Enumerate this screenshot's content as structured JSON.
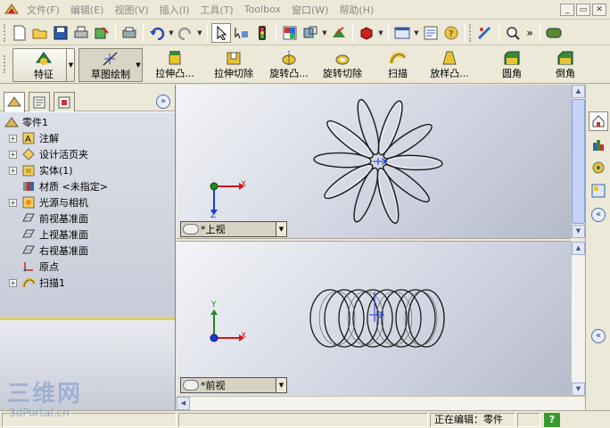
{
  "menu": {
    "items": [
      "文件(F)",
      "编辑(E)",
      "视图(V)",
      "插入(I)",
      "工具(T)",
      "Toolbox",
      "窗口(W)",
      "帮助(H)"
    ]
  },
  "command_manager": {
    "features_label": "特征",
    "sketch_label": "草图绘制",
    "commands": [
      "拉伸凸...",
      "拉伸切除",
      "旋转凸...",
      "旋转切除",
      "扫描",
      "放样凸...",
      "圆角",
      "倒角"
    ]
  },
  "feature_tree": {
    "root": "零件1",
    "items": [
      {
        "label": "注解",
        "icon": "annotation-icon",
        "expandable": true
      },
      {
        "label": "设计活页夹",
        "icon": "design-binder-icon",
        "expandable": true
      },
      {
        "label": "实体(1)",
        "icon": "solid-bodies-icon",
        "expandable": true
      },
      {
        "label": "材质 <未指定>",
        "icon": "material-icon",
        "expandable": false
      },
      {
        "label": "光源与相机",
        "icon": "lights-cameras-icon",
        "expandable": true
      },
      {
        "label": "前视基准面",
        "icon": "plane-icon",
        "expandable": false
      },
      {
        "label": "上视基准面",
        "icon": "plane-icon",
        "expandable": false
      },
      {
        "label": "右视基准面",
        "icon": "plane-icon",
        "expandable": false
      },
      {
        "label": "原点",
        "icon": "origin-icon",
        "expandable": false
      },
      {
        "label": "扫描1",
        "icon": "sweep-icon",
        "expandable": true
      }
    ]
  },
  "viewports": {
    "top_label": "*上视",
    "bottom_label": "*前视",
    "axis_x": "X",
    "axis_y": "Y",
    "axis_z": "Z"
  },
  "status": {
    "text": "正在编辑：零件",
    "help": "?"
  },
  "watermark": {
    "big": "三维网",
    "small": "3dPortal.cn"
  },
  "colors": {
    "axis_x": "#d01818",
    "axis_y": "#1a8a1a",
    "axis_z": "#1a3ad8",
    "highlight_line": "#e8d21c"
  }
}
